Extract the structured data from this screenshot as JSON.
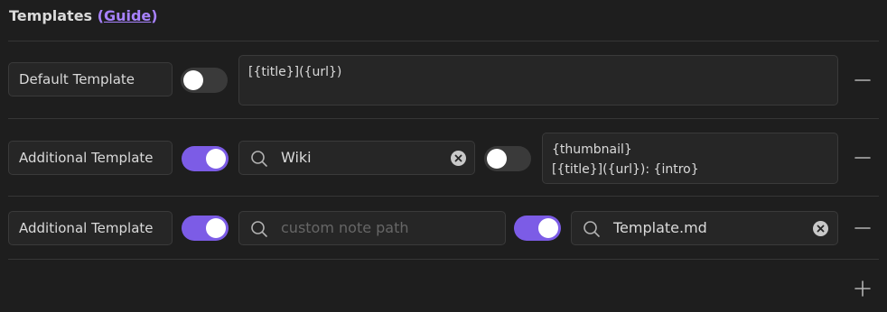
{
  "section": {
    "title": "Templates",
    "guide_link": "Guide"
  },
  "rows": [
    {
      "label": "Default Template",
      "enabled": false,
      "template_text": "[{title}]({url})",
      "remove_icon": "minus-icon"
    },
    {
      "label": "Additional Template",
      "enabled": true,
      "search_value": "Wiki",
      "search_placeholder": "",
      "secondary_enabled": false,
      "template_text": "{thumbnail}\n[{title}]({url}): {intro}",
      "remove_icon": "minus-icon"
    },
    {
      "label": "Additional Template",
      "enabled": true,
      "search_value": "",
      "search_placeholder": "custom note path",
      "secondary_enabled": true,
      "template_file": "Template.md",
      "remove_icon": "minus-icon"
    }
  ],
  "add_icon": "plus-icon",
  "colors": {
    "accent": "#7c5ce6",
    "link": "#a882ff",
    "background": "#1e1e1e"
  }
}
